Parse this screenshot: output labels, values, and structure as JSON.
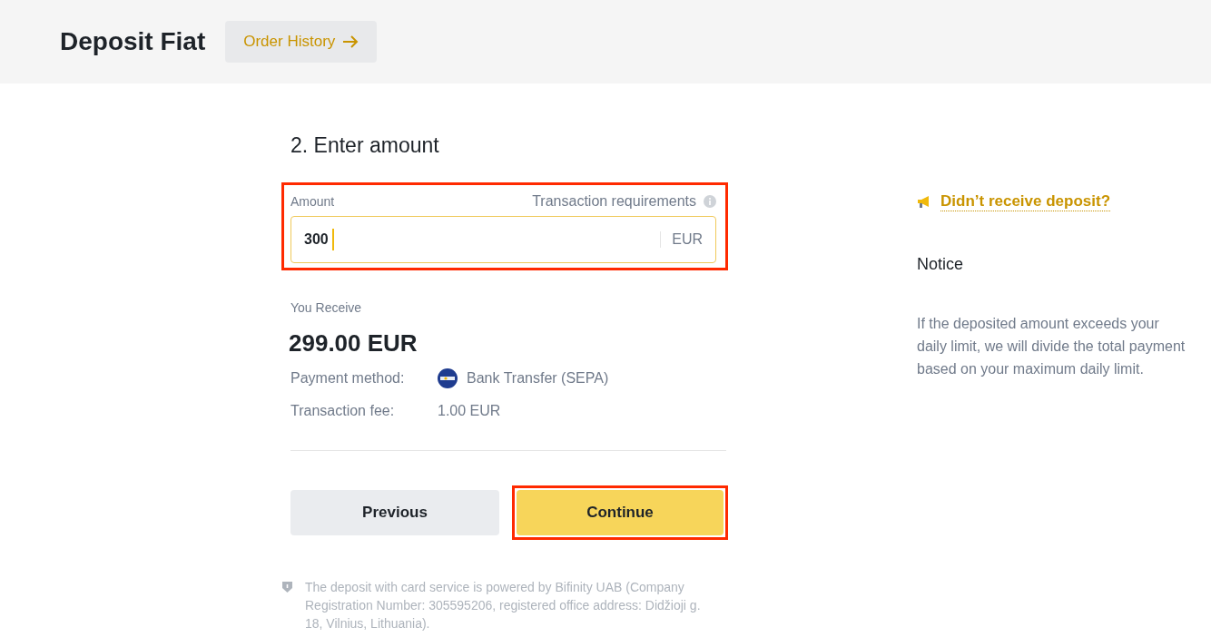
{
  "header": {
    "title": "Deposit Fiat",
    "history_button": "Order History"
  },
  "step": {
    "title": "2. Enter amount"
  },
  "amount_field": {
    "label": "Amount",
    "requirements_link": "Transaction requirements",
    "value": "300",
    "currency": "EUR",
    "focused": true
  },
  "receive": {
    "label": "You Receive",
    "amount": "299.00 EUR"
  },
  "details": [
    {
      "label": "Payment method:",
      "value": "Bank Transfer (SEPA)",
      "kind": "method"
    },
    {
      "label": "Transaction fee:",
      "value": "1.00 EUR",
      "kind": "plain"
    }
  ],
  "buttons": [
    {
      "label": "Previous",
      "kind": "secondary"
    },
    {
      "label": "Continue",
      "kind": "primary"
    }
  ],
  "disclaimer": "The deposit with card service is powered by Bifinity UAB (Company Registration Number: 305595206, registered office address: Didžioji g. 18, Vilnius, Lithuania).",
  "sidebar": {
    "link": "Didn’t receive deposit?",
    "notice_title": "Notice",
    "notice_text": "If the deposited amount exceeds your daily limit, we will divide the total payment based on your maximum daily limit."
  }
}
